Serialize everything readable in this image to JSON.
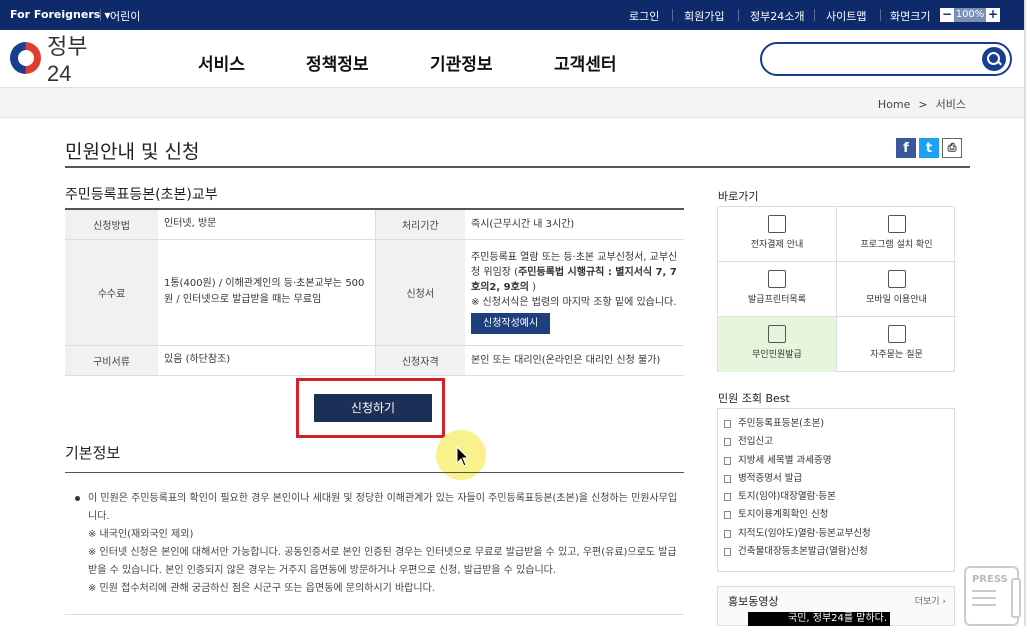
{
  "topbar": {
    "foreigners": "For Foreigners",
    "kids": "어린이",
    "login": "로그인",
    "join": "회원가입",
    "about": "정부24소개",
    "sitemap": "사이트맵",
    "screensize": "화면크기",
    "zoom_minus": "−",
    "zoom_value": "100%",
    "zoom_plus": "+"
  },
  "header": {
    "logo_text": "정부24",
    "nav": [
      "서비스",
      "정책정보",
      "기관정보",
      "고객센터"
    ],
    "search_placeholder": ""
  },
  "breadcrumb": {
    "home": "Home",
    "sep": ">",
    "current": "서비스"
  },
  "main": {
    "page_title": "민원안내 및 신청",
    "section_title": "주민등록표등본(초본)교부",
    "table": {
      "method_label": "신청방법",
      "method_value": "인터넷, 방문",
      "period_label": "처리기간",
      "period_value": "즉시(근무시간 내 3시간)",
      "fee_label": "수수료",
      "fee_value": "1통(400원) / 이해관계인의 등·초본교부는 500원 / 인터넷으로 발급받을 때는 무료임",
      "form_label": "신청서",
      "form_value_1": "주민등록표 열람 또는 등·초본 교부신청서, 교부신청 위임장 (",
      "form_value_bold": "주민등록법 시행규칙 : 별지서식 7, 7호의2, 9호의",
      "form_value_2": " )",
      "form_note": "※ 신청서식은 법령의 마지막 조항 밑에 있습니다.",
      "form_example": "신청작성예시",
      "docs_label": "구비서류",
      "docs_value": "있음 (하단참조)",
      "qual_label": "신청자격",
      "qual_value": "본인 또는 대리인(온라인은 대리인 신청 불가)"
    },
    "apply_button": "신청하기",
    "basic_title": "기본정보",
    "basic_lines": [
      "이 민원은 주민등록표의 확인이 필요한 경우 본인이나 세대원 및 정당한 이해관계가 있는 자들이 주민등록표등본(초본)을 신청하는 민원사무입니다.",
      "※ 내국인(재외국인 제외)",
      "※ 인터넷 신청은 본인에 대해서만 가능합니다. 공동인증서로 본인 인증된 경우는 인터넷으로 무료로 발급받을 수 있고, 우편(유료)으로도 발급받을 수 있습니다. 본인 인증되지 않은 경우는 거주지 읍면동에 방문하거나 우편으로 신청, 발급받을 수 있습니다.",
      "※ 민원 접수처리에 관해 궁금하신 점은 시군구 또는 읍면동에 문의하시기 바랍니다."
    ]
  },
  "sidebar": {
    "quick_title": "바로가기",
    "quick_items": [
      "전자결제 안내",
      "프로그램 설치 확인",
      "발급프린터목록",
      "모바일 이용안내",
      "무인민원발급",
      "자주묻는 질문"
    ],
    "best_title": "민원 조회 Best",
    "best_items": [
      "주민등록표등본(초본)",
      "전입신고",
      "지방세 세목별 과세증명",
      "병적증명서 발급",
      "토지(임야)대장열람·등본",
      "토지이용계획확인 신청",
      "지적도(임야도)열람·등본교부신청",
      "건축물대장등초본발급(열람)신청"
    ],
    "promo_title": "홍보동영상",
    "promo_more": "더보기 ›",
    "promo_caption": "국민, 정부24를 맡하다."
  },
  "press_label": "PRESS",
  "colors": {
    "topbar": "#0f2a6b",
    "accent": "#1a3e8f",
    "highlight_box": "#d62128",
    "apply_button": "#1b2f57"
  }
}
